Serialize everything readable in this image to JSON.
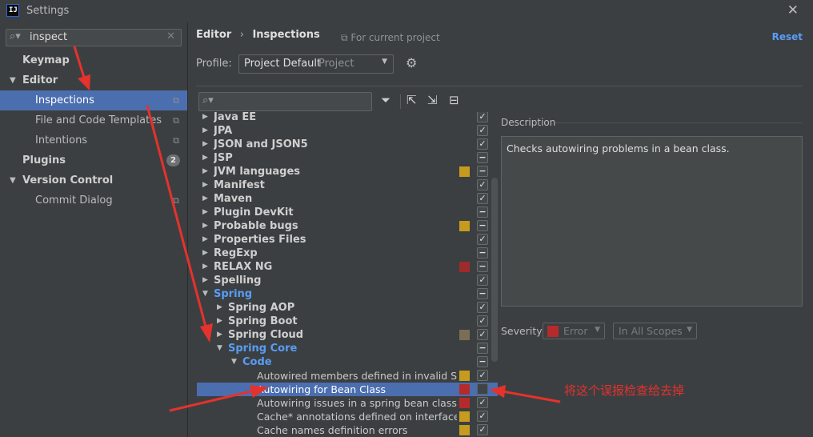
{
  "window": {
    "title": "Settings",
    "app_icon": "IJ",
    "close_icon": "close-icon"
  },
  "search": {
    "value": "inspect"
  },
  "nav": [
    {
      "label": "Keymap",
      "type": "bold"
    },
    {
      "label": "Editor",
      "type": "bold",
      "expanded": true
    },
    {
      "label": "Inspections",
      "type": "child",
      "selected": true
    },
    {
      "label": "File and Code Templates",
      "type": "child"
    },
    {
      "label": "Intentions",
      "type": "child"
    },
    {
      "label": "Plugins",
      "type": "bold",
      "badge": "2"
    },
    {
      "label": "Version Control",
      "type": "bold",
      "expanded": true
    },
    {
      "label": "Commit Dialog",
      "type": "child"
    }
  ],
  "header": {
    "crumb1": "Editor",
    "crumb_sep": "›",
    "crumb2": "Inspections",
    "for_project": "For current project",
    "reset": "Reset",
    "profile_label": "Profile:",
    "profile_value": "Project Default",
    "profile_scope": "Project"
  },
  "tree": [
    {
      "label": "Java EE",
      "level": 0,
      "kind": "collapsed",
      "severity": null,
      "check": "check"
    },
    {
      "label": "JPA",
      "level": 0,
      "kind": "collapsed",
      "severity": null,
      "check": "check"
    },
    {
      "label": "JSON and JSON5",
      "level": 0,
      "kind": "collapsed",
      "severity": null,
      "check": "check"
    },
    {
      "label": "JSP",
      "level": 0,
      "kind": "collapsed",
      "severity": null,
      "check": "dash"
    },
    {
      "label": "JVM languages",
      "level": 0,
      "kind": "collapsed",
      "severity": "#c69b1e",
      "check": "dash"
    },
    {
      "label": "Manifest",
      "level": 0,
      "kind": "collapsed",
      "severity": null,
      "check": "check"
    },
    {
      "label": "Maven",
      "level": 0,
      "kind": "collapsed",
      "severity": null,
      "check": "check"
    },
    {
      "label": "Plugin DevKit",
      "level": 0,
      "kind": "collapsed",
      "severity": null,
      "check": "dash"
    },
    {
      "label": "Probable bugs",
      "level": 0,
      "kind": "collapsed",
      "severity": "#c69b1e",
      "check": "dash"
    },
    {
      "label": "Properties Files",
      "level": 0,
      "kind": "collapsed",
      "severity": null,
      "check": "check"
    },
    {
      "label": "RegExp",
      "level": 0,
      "kind": "collapsed",
      "severity": null,
      "check": "dash"
    },
    {
      "label": "RELAX NG",
      "level": 0,
      "kind": "collapsed",
      "severity": "#9e2b2b",
      "check": "dash"
    },
    {
      "label": "Spelling",
      "level": 0,
      "kind": "collapsed",
      "severity": null,
      "check": "check"
    },
    {
      "label": "Spring",
      "level": 0,
      "kind": "expanded",
      "blue": true,
      "severity": null,
      "check": "dash"
    },
    {
      "label": "Spring AOP",
      "level": 1,
      "kind": "collapsed",
      "severity": null,
      "check": "check"
    },
    {
      "label": "Spring Boot",
      "level": 1,
      "kind": "collapsed",
      "severity": null,
      "check": "check"
    },
    {
      "label": "Spring Cloud",
      "level": 1,
      "kind": "collapsed",
      "severity": "#7a6e55",
      "check": "check"
    },
    {
      "label": "Spring Core",
      "level": 1,
      "kind": "expanded",
      "blue": true,
      "severity": null,
      "check": "dash"
    },
    {
      "label": "Code",
      "level": 2,
      "kind": "expanded",
      "blue": true,
      "severity": null,
      "check": "dash"
    },
    {
      "label": "Autowired members defined in invalid Sprin",
      "level": 3,
      "kind": "leaf",
      "severity": "#c69b1e",
      "check": "check"
    },
    {
      "label": "Autowiring for Bean Class",
      "level": 3,
      "kind": "leaf",
      "severity": "#b52b2b",
      "check": "empty",
      "selected": true
    },
    {
      "label": "Autowiring issues in a spring bean class co",
      "level": 3,
      "kind": "leaf",
      "severity": "#b52b2b",
      "check": "check"
    },
    {
      "label": "Cache* annotations defined on interfaces/in",
      "level": 3,
      "kind": "leaf",
      "severity": "#c69b1e",
      "check": "check"
    },
    {
      "label": "Cache names definition errors",
      "level": 3,
      "kind": "leaf",
      "severity": "#c69b1e",
      "check": "check"
    }
  ],
  "description": {
    "title": "Description",
    "text": "Checks autowiring problems in a bean class.",
    "severity_label": "Severity:",
    "severity_value": "Error",
    "severity_color": "#b52b2b",
    "scope_value": "In All Scopes"
  },
  "annotation": {
    "text": "将这个误报检查给去掉",
    "color": "#e5322d"
  },
  "toolbar_icons": [
    "filter-icon",
    "expand-all-icon",
    "collapse-all-icon",
    "reset-to-default-icon"
  ]
}
